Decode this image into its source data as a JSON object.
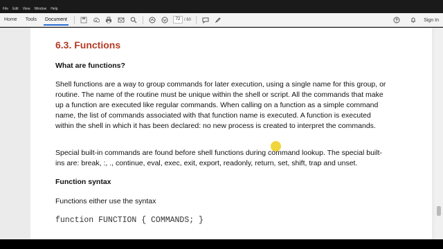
{
  "menubar": {
    "items": [
      "File",
      "Edit",
      "View",
      "Window",
      "Help"
    ]
  },
  "toolbar": {
    "tabs": [
      "Home",
      "Tools",
      "Document"
    ],
    "page_current": "72",
    "page_total": "/ 80",
    "sign_in": "Sign In",
    "icons": [
      "save-icon",
      "upload-icon",
      "print-icon",
      "email-icon",
      "search-icon",
      "page-up-icon",
      "page-down-icon",
      "comment-icon",
      "pen-icon",
      "help-icon",
      "bell-icon"
    ]
  },
  "document": {
    "section_title": "6.3. Functions",
    "subheading": "What are functions?",
    "paragraph1": "Shell functions are a way to group commands for later execution, using a single name for this group, or routine. The name of the routine must be unique within the shell or script. All the commands that make up a function are executed like regular commands. When calling on a function as a simple command name, the list of commands associated with that function name is executed. A function is executed within the shell in which it has been declared: no new process is created to interpret the commands.",
    "paragraph2": "Special built-in commands are found before shell functions during command lookup. The special built-ins are: break, :, ., continue, eval, exec, exit, export, readonly, return, set, shift, trap and unset.",
    "syntax_heading": "Function syntax",
    "paragraph3": "Functions either use the syntax",
    "code_line": "function FUNCTION { COMMANDS; }"
  },
  "colors": {
    "heading": "#b33a22",
    "accent_tab": "#2a6fd6",
    "cursor_highlight": "#eed028"
  }
}
